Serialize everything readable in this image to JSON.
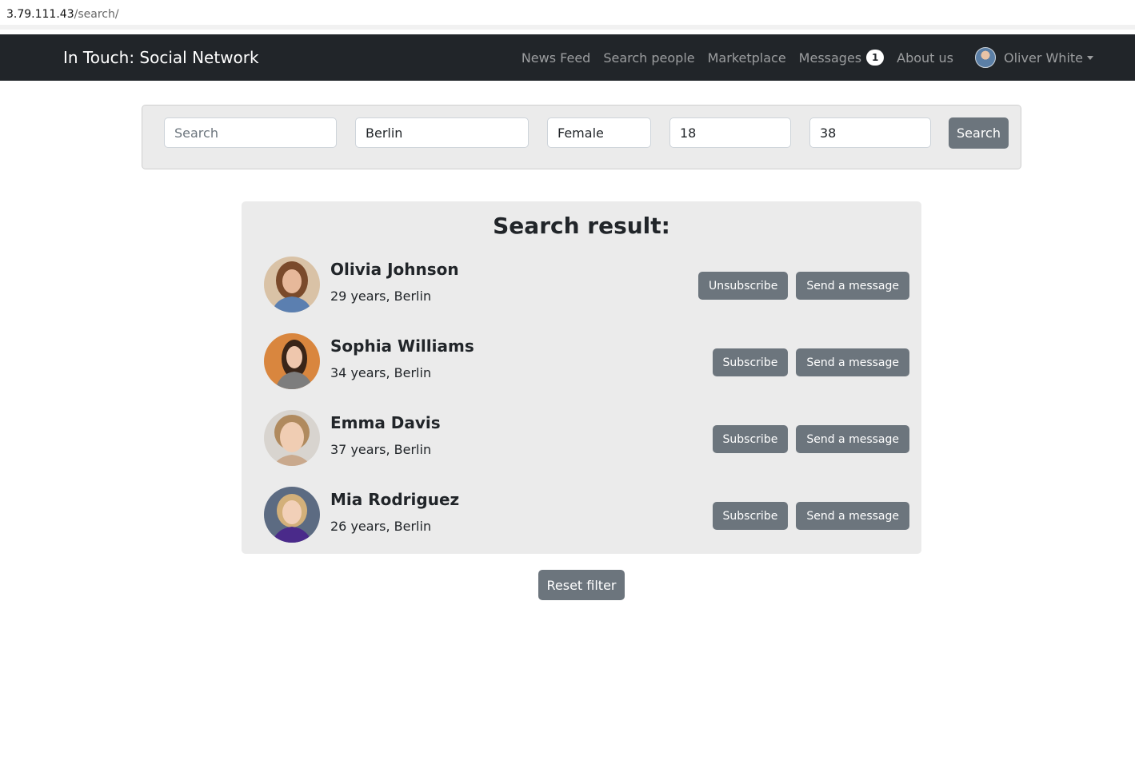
{
  "browser": {
    "url_host": "3.79.111.43",
    "url_path": "/search/"
  },
  "navbar": {
    "brand": "In Touch: Social Network",
    "links": [
      {
        "label": "News Feed"
      },
      {
        "label": "Search people"
      },
      {
        "label": "Marketplace"
      },
      {
        "label": "Messages",
        "badge": "1"
      },
      {
        "label": "About us"
      }
    ],
    "user": {
      "name": "Oliver White"
    }
  },
  "filters": {
    "search": {
      "value": "",
      "placeholder": "Search"
    },
    "city": {
      "value": "Berlin"
    },
    "gender": {
      "value": "Female"
    },
    "age_from": {
      "value": "18"
    },
    "age_to": {
      "value": "38"
    },
    "search_button": "Search"
  },
  "results": {
    "title": "Search result:",
    "people": [
      {
        "name": "Olivia Johnson",
        "info": "29 years, Berlin",
        "subscribe_label": "Unsubscribe",
        "message_label": "Send a message"
      },
      {
        "name": "Sophia Williams",
        "info": "34 years, Berlin",
        "subscribe_label": "Subscribe",
        "message_label": "Send a message"
      },
      {
        "name": "Emma Davis",
        "info": "37 years, Berlin",
        "subscribe_label": "Subscribe",
        "message_label": "Send a message"
      },
      {
        "name": "Mia Rodriguez",
        "info": "26 years, Berlin",
        "subscribe_label": "Subscribe",
        "message_label": "Send a message"
      }
    ]
  },
  "reset_button": "Reset filter",
  "colors": {
    "navbar_bg": "#212529",
    "button_gray": "#6c757d",
    "panel_bg": "#ebebeb"
  }
}
